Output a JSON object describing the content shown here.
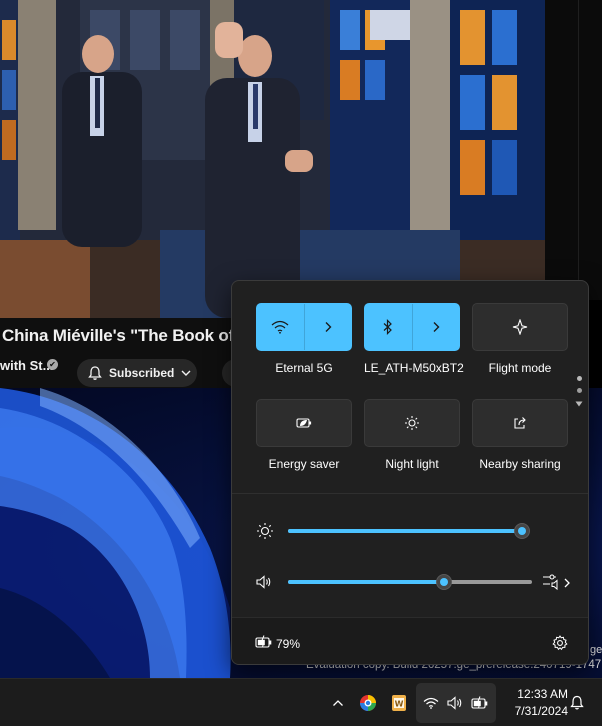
{
  "video": {
    "title": "China Miéville's \"The Book of Els",
    "channel": "with St...",
    "subscribe_label": "Subscribed"
  },
  "quick_settings": {
    "tiles": [
      {
        "label": "Eternal 5G",
        "state": "on",
        "icon": "wifi-icon",
        "has_arrow": true
      },
      {
        "label": "LE_ATH-M50xBT2",
        "state": "on",
        "icon": "bluetooth-icon",
        "has_arrow": true
      },
      {
        "label": "Flight mode",
        "state": "off",
        "icon": "airplane-icon",
        "has_arrow": false
      },
      {
        "label": "Energy saver",
        "state": "off",
        "icon": "energy-saver-icon",
        "has_arrow": false
      },
      {
        "label": "Night light",
        "state": "off",
        "icon": "night-light-icon",
        "has_arrow": false
      },
      {
        "label": "Nearby sharing",
        "state": "off",
        "icon": "share-icon",
        "has_arrow": false
      }
    ],
    "brightness_level": 0.99,
    "volume_level": 0.64,
    "battery_percent": "79%"
  },
  "watermark": {
    "build_text": "Evaluation copy. Build 26257.ge_prerelease.240719-1747",
    "cut_text": "ge"
  },
  "taskbar": {
    "time": "12:33 AM",
    "date": "7/31/2024"
  },
  "colors": {
    "accent": "#4cc2ff",
    "flyout_bg": "#202020",
    "taskbar_bg": "#1c1c1c"
  }
}
